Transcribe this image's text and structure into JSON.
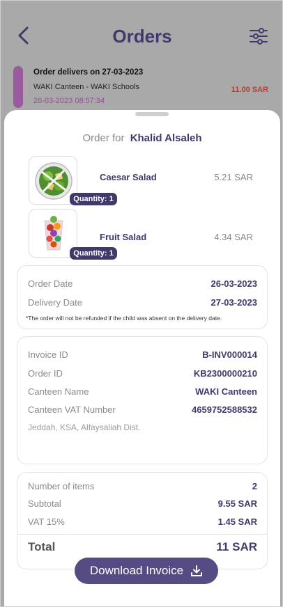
{
  "header": {
    "title": "Orders",
    "back_icon": "chevron-left-icon",
    "filter_icon": "sliders-icon"
  },
  "background_order": {
    "title": "Order delivers on 27-03-2023",
    "subtitle": "WAKI Canteen - WAKI Schools",
    "timestamp": "26-03-2023 08:57:34",
    "amount": "11.00 SAR"
  },
  "sheet": {
    "order_for_label": "Order for",
    "customer_name": "Khalid Alsaleh",
    "items": [
      {
        "name": "Caesar Salad",
        "price": "5.21 SAR",
        "quantity": "Quantity: 1",
        "icon": "salad-bowl-icon"
      },
      {
        "name": "Fruit Salad",
        "price": "4.34 SAR",
        "quantity": "Quantity: 1",
        "icon": "fruit-cup-icon"
      }
    ],
    "dates": {
      "order_date_label": "Order Date",
      "order_date": "26-03-2023",
      "delivery_date_label": "Delivery Date",
      "delivery_date": "27-03-2023",
      "note": "*The order will not be refunded if the child was absent on the delivery date."
    },
    "invoice": {
      "invoice_id_label": "Invoice ID",
      "invoice_id": "B-INV000014",
      "order_id_label": "Order ID",
      "order_id": "KB2300000210",
      "canteen_name_label": "Canteen Name",
      "canteen_name": "WAKI Canteen",
      "vat_number_label": "Canteen VAT Number",
      "vat_number": "4659752588532",
      "address": "Jeddah, KSA, Alfaysaliah Dist."
    },
    "summary": {
      "items_label": "Number of items",
      "items_count": "2",
      "subtotal_label": "Subtotal",
      "subtotal": "9.55 SAR",
      "vat_label": "VAT 15%",
      "vat": "1.45 SAR",
      "total_label": "Total",
      "total": "11 SAR"
    },
    "download_label": "Download Invoice",
    "download_icon": "download-icon"
  },
  "colors": {
    "brand": "#3f3a6b",
    "button": "#564b82",
    "accent": "#9a5a9e",
    "amount": "#c0392b"
  }
}
